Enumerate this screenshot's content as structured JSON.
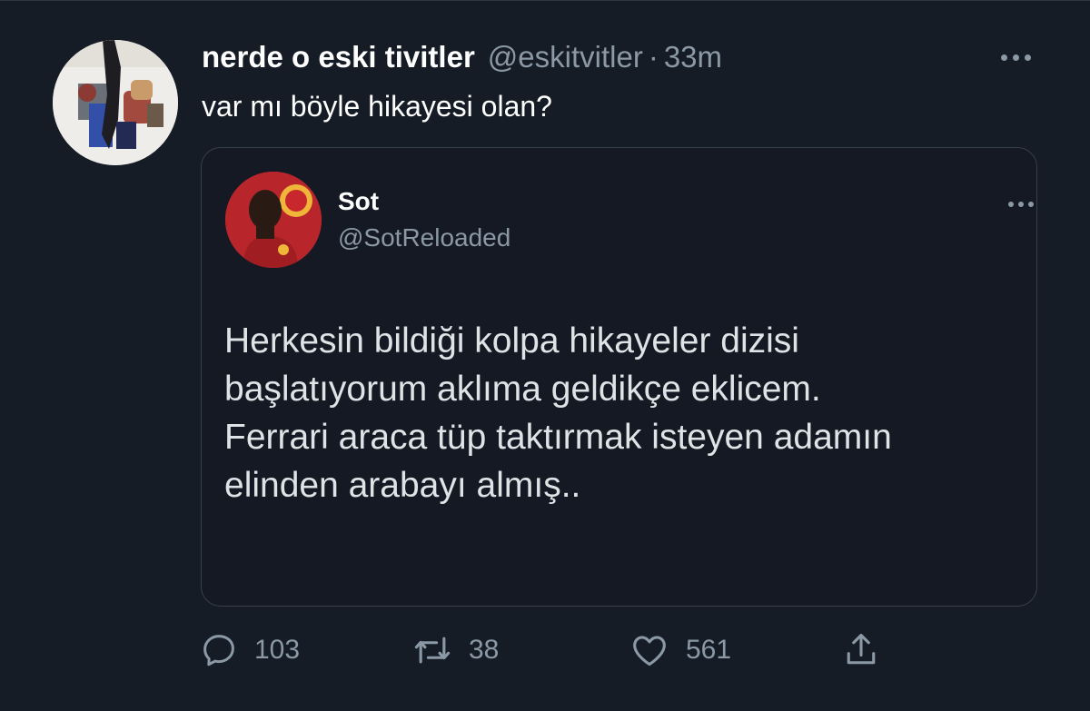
{
  "tweet": {
    "author_name": "nerde o eski tivitler",
    "author_handle": "@eskitvitler",
    "separator": "·",
    "time": "33m",
    "text": "var mı böyle hikayesi olan?"
  },
  "quote": {
    "author_name": "Sot",
    "author_handle": "@SotReloaded",
    "lines": [
      "Herkesin bildiği kolpa hikayeler dizisi",
      "başlatıyorum aklıma geldikçe eklicem.",
      "Ferrari araca tüp taktırmak isteyen adamın",
      "elinden arabayı almış.."
    ]
  },
  "actions": {
    "reply_count": "103",
    "retweet_count": "38",
    "like_count": "561"
  },
  "icons": {
    "reply": "reply-icon",
    "retweet": "retweet-icon",
    "like": "heart-icon",
    "share": "share-icon",
    "more": "more-icon"
  },
  "colors": {
    "background": "#161c26",
    "secondary_text": "#8b98a5",
    "primary_text": "#ffffff",
    "border": "#38404b"
  }
}
